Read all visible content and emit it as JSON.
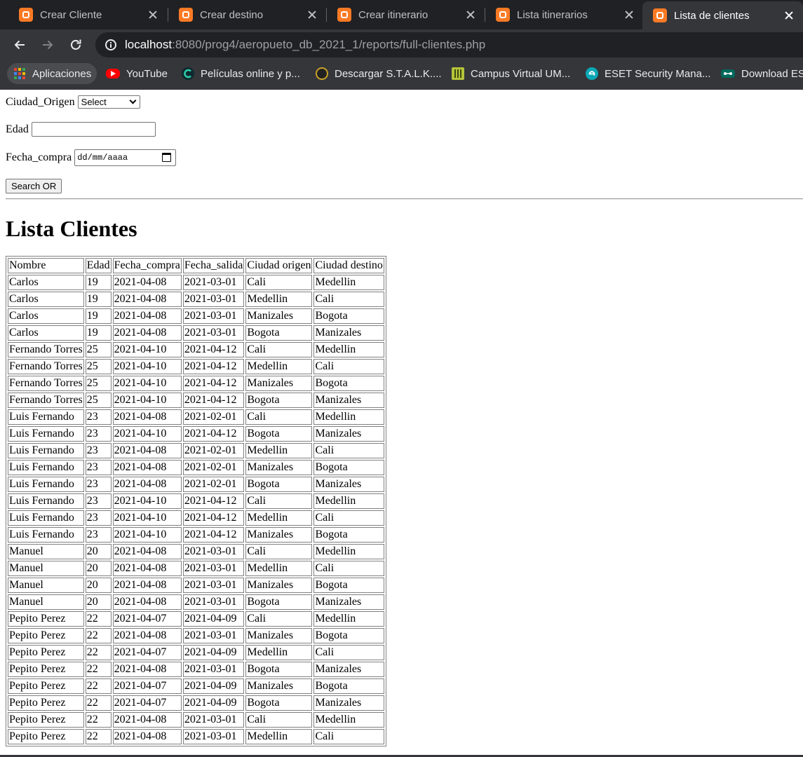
{
  "tabs": [
    {
      "title": "Crear Cliente",
      "active": false
    },
    {
      "title": "Crear destino",
      "active": false
    },
    {
      "title": "Crear itinerario",
      "active": false
    },
    {
      "title": "Lista itinerarios",
      "active": false
    },
    {
      "title": "Lista de clientes",
      "active": true
    }
  ],
  "address_bar": {
    "host": "localhost",
    "rest": ":8080/prog4/aeropueto_db_2021_1/reports/full-clientes.php"
  },
  "bookmarks": [
    {
      "label": "Aplicaciones",
      "icon": "apps-grid-icon"
    },
    {
      "label": "YouTube",
      "icon": "youtube-icon"
    },
    {
      "label": "Películas online y p...",
      "icon": "cuevana-icon"
    },
    {
      "label": "Descargar S.T.A.L.K....",
      "icon": "stalker-icon"
    },
    {
      "label": "Campus Virtual UM...",
      "icon": "campus-icon"
    },
    {
      "label": "ESET Security Mana...",
      "icon": "eset-icon"
    },
    {
      "label": "Download ES",
      "icon": "download-icon"
    }
  ],
  "form": {
    "ciudad_label": "Ciudad_Origen",
    "ciudad_selected": "Select",
    "edad_label": "Edad",
    "edad_value": "",
    "fecha_label": "Fecha_compra",
    "fecha_placeholder": "dd/mm/aaaa",
    "search_button": "Search OR"
  },
  "heading": "Lista Clientes",
  "table": {
    "headers": [
      "Nombre",
      "Edad",
      "Fecha_compra",
      "Fecha_salida",
      "Ciudad origen",
      "Ciudad destino"
    ],
    "rows": [
      [
        "Carlos",
        "19",
        "2021-04-08",
        "2021-03-01",
        "Cali",
        "Medellin"
      ],
      [
        "Carlos",
        "19",
        "2021-04-08",
        "2021-03-01",
        "Medellin",
        "Cali"
      ],
      [
        "Carlos",
        "19",
        "2021-04-08",
        "2021-03-01",
        "Manizales",
        "Bogota"
      ],
      [
        "Carlos",
        "19",
        "2021-04-08",
        "2021-03-01",
        "Bogota",
        "Manizales"
      ],
      [
        "Fernando Torres",
        "25",
        "2021-04-10",
        "2021-04-12",
        "Cali",
        "Medellin"
      ],
      [
        "Fernando Torres",
        "25",
        "2021-04-10",
        "2021-04-12",
        "Medellin",
        "Cali"
      ],
      [
        "Fernando Torres",
        "25",
        "2021-04-10",
        "2021-04-12",
        "Manizales",
        "Bogota"
      ],
      [
        "Fernando Torres",
        "25",
        "2021-04-10",
        "2021-04-12",
        "Bogota",
        "Manizales"
      ],
      [
        "Luis Fernando",
        "23",
        "2021-04-08",
        "2021-02-01",
        "Cali",
        "Medellin"
      ],
      [
        "Luis Fernando",
        "23",
        "2021-04-10",
        "2021-04-12",
        "Bogota",
        "Manizales"
      ],
      [
        "Luis Fernando",
        "23",
        "2021-04-08",
        "2021-02-01",
        "Medellin",
        "Cali"
      ],
      [
        "Luis Fernando",
        "23",
        "2021-04-08",
        "2021-02-01",
        "Manizales",
        "Bogota"
      ],
      [
        "Luis Fernando",
        "23",
        "2021-04-08",
        "2021-02-01",
        "Bogota",
        "Manizales"
      ],
      [
        "Luis Fernando",
        "23",
        "2021-04-10",
        "2021-04-12",
        "Cali",
        "Medellin"
      ],
      [
        "Luis Fernando",
        "23",
        "2021-04-10",
        "2021-04-12",
        "Medellin",
        "Cali"
      ],
      [
        "Luis Fernando",
        "23",
        "2021-04-10",
        "2021-04-12",
        "Manizales",
        "Bogota"
      ],
      [
        "Manuel",
        "20",
        "2021-04-08",
        "2021-03-01",
        "Cali",
        "Medellin"
      ],
      [
        "Manuel",
        "20",
        "2021-04-08",
        "2021-03-01",
        "Medellin",
        "Cali"
      ],
      [
        "Manuel",
        "20",
        "2021-04-08",
        "2021-03-01",
        "Manizales",
        "Bogota"
      ],
      [
        "Manuel",
        "20",
        "2021-04-08",
        "2021-03-01",
        "Bogota",
        "Manizales"
      ],
      [
        "Pepito Perez",
        "22",
        "2021-04-07",
        "2021-04-09",
        "Cali",
        "Medellin"
      ],
      [
        "Pepito Perez",
        "22",
        "2021-04-08",
        "2021-03-01",
        "Manizales",
        "Bogota"
      ],
      [
        "Pepito Perez",
        "22",
        "2021-04-07",
        "2021-04-09",
        "Medellin",
        "Cali"
      ],
      [
        "Pepito Perez",
        "22",
        "2021-04-08",
        "2021-03-01",
        "Bogota",
        "Manizales"
      ],
      [
        "Pepito Perez",
        "22",
        "2021-04-07",
        "2021-04-09",
        "Manizales",
        "Bogota"
      ],
      [
        "Pepito Perez",
        "22",
        "2021-04-07",
        "2021-04-09",
        "Bogota",
        "Manizales"
      ],
      [
        "Pepito Perez",
        "22",
        "2021-04-08",
        "2021-03-01",
        "Cali",
        "Medellin"
      ],
      [
        "Pepito Perez",
        "22",
        "2021-04-08",
        "2021-03-01",
        "Medellin",
        "Cali"
      ]
    ]
  },
  "colors": {
    "chrome_dark": "#202124",
    "chrome_toolbar": "#35363a",
    "xampp_orange": "#fb7a24"
  }
}
